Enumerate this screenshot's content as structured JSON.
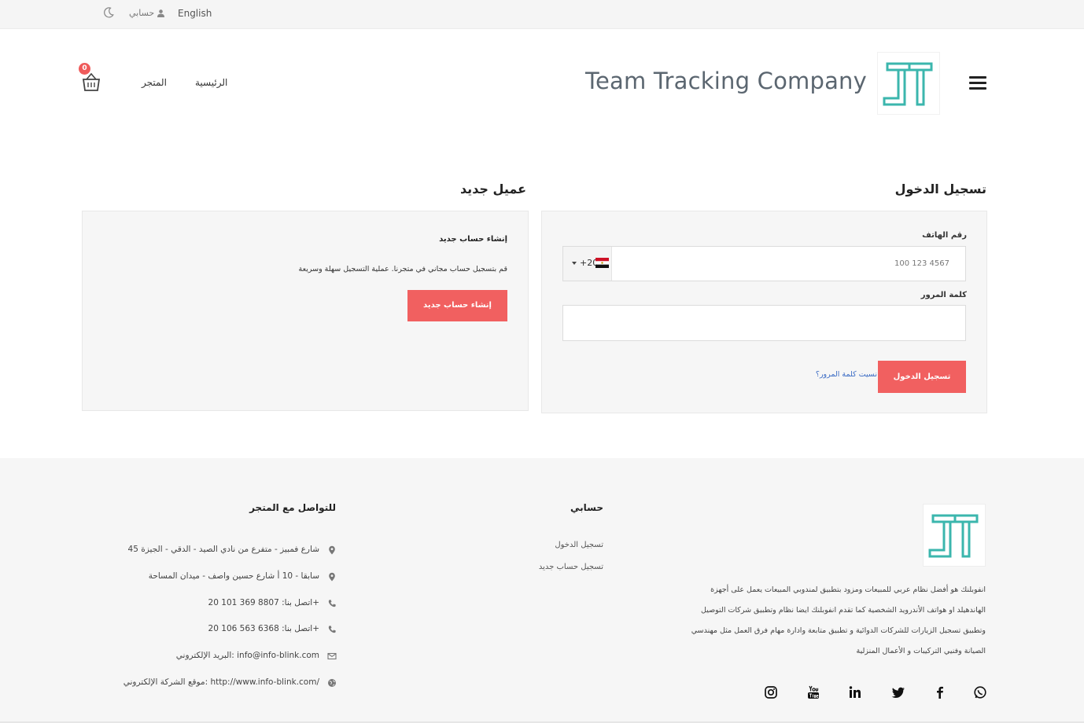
{
  "topbar": {
    "language": "English",
    "account": "حسابي"
  },
  "header": {
    "brand": "Team Tracking Company",
    "nav_home": "الرئيسية",
    "nav_store": "المتجر",
    "cart_count": "0"
  },
  "login": {
    "heading": "تسجيل الدخول",
    "phone_label": "رقم الهاتف",
    "phone_placeholder": "100 123 4567",
    "country_code": "+20",
    "password_label": "كلمة المرور",
    "submit": "تسجيل الدخول",
    "forgot": "نسيت كلمة المرور؟"
  },
  "new_customer": {
    "heading": "عميل جديد",
    "title": "إنشاء حساب جديد",
    "description": "قم بتسجيل حساب مجاني في متجرنا. عملية التسجيل سهلة وسريعة",
    "button": "إنشاء حساب جديد"
  },
  "footer": {
    "about": "انفوبلنك هو أفضل نظام عربي للمبيعات ومزود بتطبيق لمندوبي المبيعات يعمل على أجهزة الهاندهيلد او هواتف الأندرويد الشخصية كما تقدم انفوبلنك ايضا نظام وتطبيق شركات التوصيل وتطبيق تسجيل الزيارات للشركات الدوائية و تطبيق متابعة وادارة مهام فرق العمل مثل مهندسي الصيانة وفنيي التركيبات و الأعمال المنزلية",
    "account_heading": "حسابي",
    "account_links": [
      "تسجيل الدخول",
      "تسجيل حساب جديد"
    ],
    "contact_heading": "للتواصل مع المتجر",
    "contact": [
      "45 شارع فمبيز - متفرع من نادي الصيد - الدقي - الجيزة",
      "سابقا - 10 أ شارع حسين واصف - ميدان المساحة",
      "اتصل بنا: 8807 369 101 20+",
      "اتصل بنا: 6368 563 106 20+",
      "البريد الإلكتروني: info@info-blink.com",
      "موقع الشركة الإلكتروني: http://www.info-blink.com/"
    ]
  },
  "colors": {
    "accent": "#f16060",
    "logo": "#3bb6ad",
    "link": "#3a6bc4"
  }
}
